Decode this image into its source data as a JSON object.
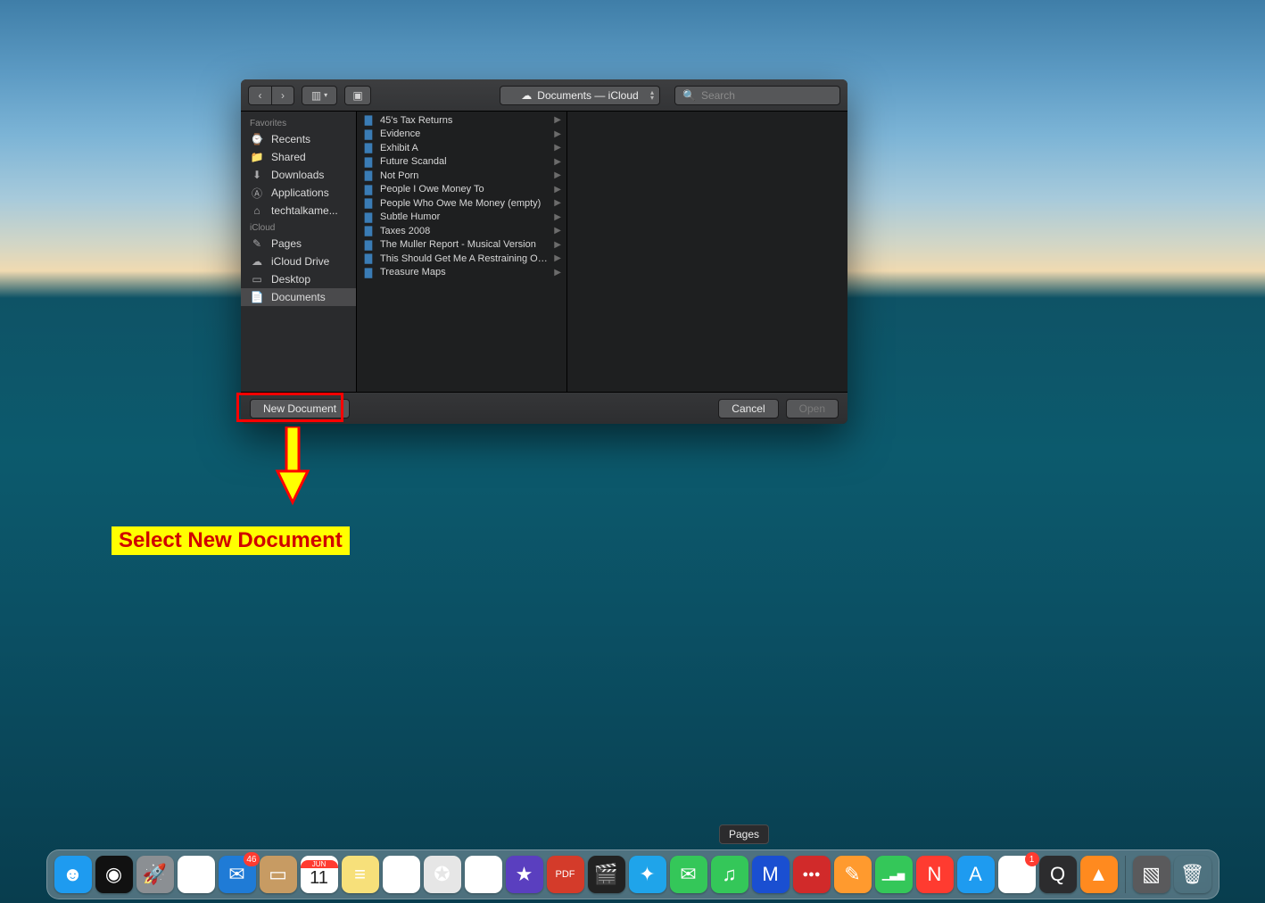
{
  "dialog": {
    "path_label": "Documents — iCloud",
    "search_placeholder": "Search",
    "footer": {
      "new_document": "New Document",
      "cancel": "Cancel",
      "open": "Open"
    }
  },
  "sidebar": {
    "groups": [
      {
        "label": "Favorites",
        "items": [
          {
            "icon": "recents",
            "label": "Recents"
          },
          {
            "icon": "folder",
            "label": "Shared"
          },
          {
            "icon": "download",
            "label": "Downloads"
          },
          {
            "icon": "apps",
            "label": "Applications"
          },
          {
            "icon": "home",
            "label": "techtalkame..."
          }
        ]
      },
      {
        "label": "iCloud",
        "items": [
          {
            "icon": "pages",
            "label": "Pages"
          },
          {
            "icon": "cloud",
            "label": "iCloud Drive"
          },
          {
            "icon": "desktop",
            "label": "Desktop"
          },
          {
            "icon": "doc",
            "label": "Documents",
            "selected": true
          }
        ]
      }
    ]
  },
  "files": [
    "45's Tax Returns",
    "Evidence",
    "Exhibit A",
    "Future Scandal",
    "Not Porn",
    "People I Owe Money To",
    "People Who Owe Me Money (empty)",
    "Subtle Humor",
    "Taxes 2008",
    "The Muller Report - Musical Version",
    "This Should Get Me A Restraining Order",
    "Treasure Maps"
  ],
  "annotation": {
    "label": "Select New Document"
  },
  "dock": {
    "tooltip": "Pages",
    "items": [
      {
        "name": "finder",
        "bg": "#1e9bf0",
        "glyph": "☻"
      },
      {
        "name": "siri",
        "bg": "#111",
        "glyph": "◉"
      },
      {
        "name": "launchpad",
        "bg": "#8b8f93",
        "glyph": "🚀"
      },
      {
        "name": "chrome",
        "bg": "#fff",
        "glyph": "◎"
      },
      {
        "name": "mail",
        "bg": "#1f7bd6",
        "glyph": "✉",
        "badge": "46"
      },
      {
        "name": "contacts",
        "bg": "#c79b63",
        "glyph": "▭"
      },
      {
        "name": "calendar",
        "bg": "#fff",
        "glyph": "11",
        "top": "JUN"
      },
      {
        "name": "notes",
        "bg": "#f7e07a",
        "glyph": "≡"
      },
      {
        "name": "reminders",
        "bg": "#fff",
        "glyph": "≣"
      },
      {
        "name": "maps",
        "bg": "#e6e6e6",
        "glyph": "✪"
      },
      {
        "name": "photos",
        "bg": "#fff",
        "glyph": "✿"
      },
      {
        "name": "imovie",
        "bg": "#5a3fbf",
        "glyph": "★"
      },
      {
        "name": "pdf",
        "bg": "#d43b2a",
        "glyph": "PDF",
        "small": true
      },
      {
        "name": "clapper",
        "bg": "#222",
        "glyph": "🎬"
      },
      {
        "name": "safari",
        "bg": "#1fa4ea",
        "glyph": "✦"
      },
      {
        "name": "messages",
        "bg": "#34c759",
        "glyph": "✉"
      },
      {
        "name": "itunes",
        "bg": "#34c759",
        "glyph": "♫"
      },
      {
        "name": "malware",
        "bg": "#1a4fd1",
        "glyph": "M"
      },
      {
        "name": "1password",
        "bg": "#d12a2a",
        "glyph": "●●●",
        "small": true
      },
      {
        "name": "pages",
        "bg": "#ff9a2e",
        "glyph": "✎"
      },
      {
        "name": "numbers",
        "bg": "#34c759",
        "glyph": "▁▃▅",
        "small": true
      },
      {
        "name": "news",
        "bg": "#ff3b30",
        "glyph": "N"
      },
      {
        "name": "appstore",
        "bg": "#1e9bf0",
        "glyph": "A"
      },
      {
        "name": "xcode",
        "bg": "#fff",
        "glyph": "⚒",
        "badge": "1"
      },
      {
        "name": "quicktime",
        "bg": "#2c2c2e",
        "glyph": "Q"
      },
      {
        "name": "vlc",
        "bg": "#ff8a1f",
        "glyph": "▲"
      }
    ],
    "right": [
      {
        "name": "downloads-stack",
        "bg": "#5a5a5c",
        "glyph": "▧"
      },
      {
        "name": "trash",
        "bg": "transparent",
        "glyph": "🗑"
      }
    ]
  }
}
